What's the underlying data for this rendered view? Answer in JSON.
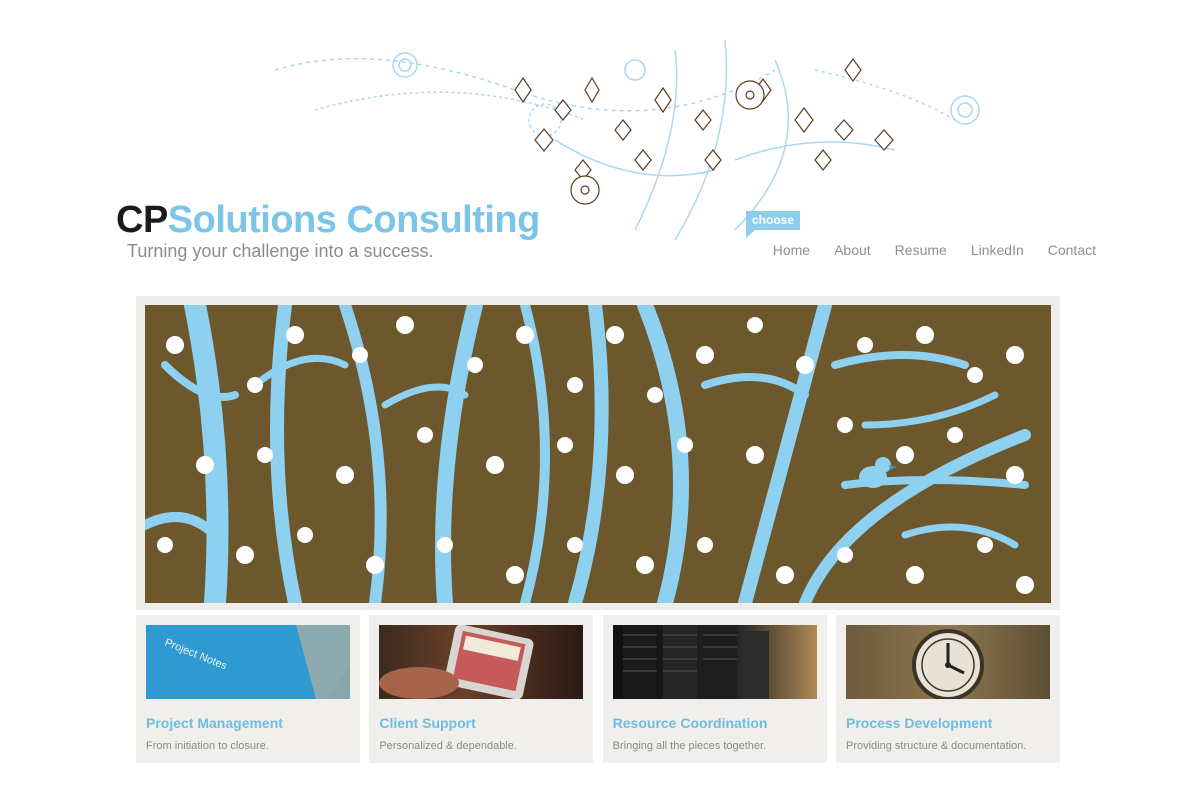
{
  "brand": {
    "logo_dark": "CP",
    "logo_light": "Solutions Consulting",
    "tagline": "Turning your challenge into a success."
  },
  "nav": {
    "choose_label": "choose",
    "items": [
      "Home",
      "About",
      "Resume",
      "LinkedIn",
      "Contact"
    ]
  },
  "cards": [
    {
      "title": "Project Management",
      "subtitle": "From initiation to closure.",
      "image_text": "Project Notes"
    },
    {
      "title": "Client Support",
      "subtitle": "Personalized & dependable."
    },
    {
      "title": "Resource Coordination",
      "subtitle": "Bringing all the pieces together."
    },
    {
      "title": "Process Development",
      "subtitle": "Providing structure & documentation."
    }
  ],
  "colors": {
    "accent_blue": "#7cc5e8",
    "banner_brown": "#6d572c",
    "card_bg": "#f0efec",
    "text_gray": "#8a8a8a"
  },
  "icons": {
    "header_art": "floral-swirl-illustration",
    "banner": "blossom-tree-with-bird-illustration"
  }
}
